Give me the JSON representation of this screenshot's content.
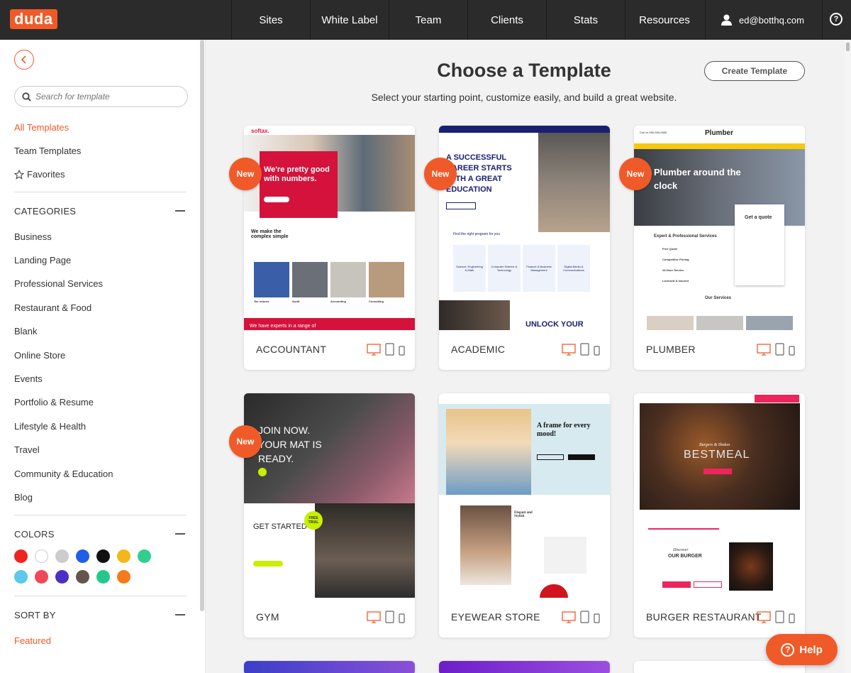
{
  "topbar": {
    "logo": "duda",
    "nav": [
      "Sites",
      "White Label",
      "Team",
      "Clients",
      "Stats",
      "Resources"
    ],
    "user_email": "ed@botthq.com",
    "help_glyph": "?"
  },
  "sidebar": {
    "search_placeholder": "Search for template",
    "links": [
      "All Templates",
      "Team Templates",
      "Favorites"
    ],
    "categories_heading": "CATEGORIES",
    "categories": [
      "Business",
      "Landing Page",
      "Professional Services",
      "Restaurant & Food",
      "Blank",
      "Online Store",
      "Events",
      "Portfolio & Resume",
      "Lifestyle & Health",
      "Travel",
      "Community & Education",
      "Blog"
    ],
    "colors_heading": "COLORS",
    "colors": [
      "#f0241e",
      "#ffffff",
      "#cccccc",
      "#1f5fe8",
      "#111111",
      "#f5b619",
      "#2fcf8e",
      "#5cc8ea",
      "#ef4857",
      "#4b2fc4",
      "#65554d",
      "#23c98a",
      "#f57a1a"
    ],
    "sort_heading": "SORT BY",
    "sort_value": "Featured"
  },
  "main": {
    "title": "Choose a Template",
    "subtitle": "Select your starting point, customize easily, and build a great website.",
    "create_button": "Create Template",
    "new_badge": "New",
    "templates": [
      {
        "name": "ACCOUNTANT",
        "is_new": true
      },
      {
        "name": "ACADEMIC",
        "is_new": true
      },
      {
        "name": "PLUMBER",
        "is_new": true
      },
      {
        "name": "GYM",
        "is_new": true
      },
      {
        "name": "EYEWEAR STORE",
        "is_new": false
      },
      {
        "name": "BURGER RESTAURANT",
        "is_new": false
      }
    ],
    "thumbs": {
      "accountant": {
        "brand": "softax.",
        "hero": "We're pretty good with numbers.",
        "section": "We make the complex simple",
        "items": [
          "Tax returns",
          "Audit",
          "Accounting",
          "Consulting"
        ],
        "footer": "We have experts in a range of"
      },
      "academic": {
        "hero": "A SUCCESSFUL CAREER STARTS WITH A GREAT EDUCATION",
        "prompt": "Find the right program for you",
        "programs": [
          "Science, Engineering & Math",
          "Computer Science & Technology",
          "Finance & Business Management",
          "Digital Media & Communications"
        ],
        "footer": "UNLOCK YOUR"
      },
      "plumber": {
        "phone": "Call us 555-555-5555",
        "brand": "Plumber",
        "hero": "Plumber around the clock",
        "quote": "Get a quote",
        "services_heading": "Expert & Professional Services",
        "services": [
          "Free Quote",
          "Competitive Pricing",
          "24-Hour Service",
          "Licensed & Insured"
        ],
        "our_services": "Our Services"
      },
      "gym": {
        "hero": "JOIN NOW. YOUR MAT IS READY.",
        "cta": "GET STARTED",
        "badge": "FREE TRIAL"
      },
      "eyewear": {
        "hero": "A frame for every mood!",
        "section": "Elegant and Stylish"
      },
      "burger": {
        "hero": "BESTMEAL",
        "hero_small": "Burgers & Shakes",
        "section_small": "Discover",
        "section": "OUR BURGER"
      }
    }
  },
  "help_button": "Help"
}
